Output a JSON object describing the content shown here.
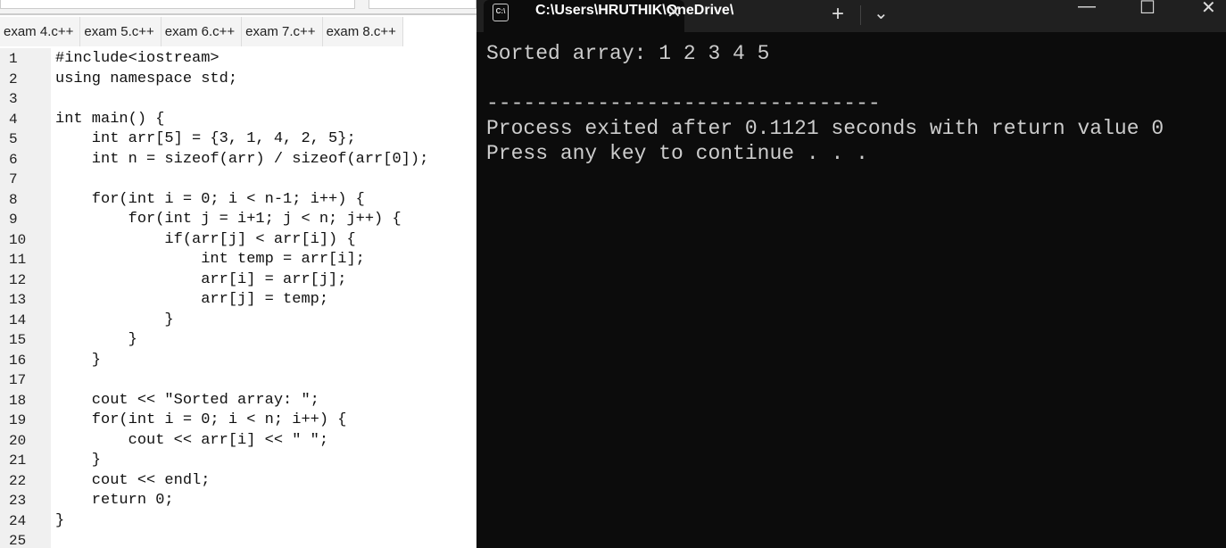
{
  "editor": {
    "tabs": [
      "exam 4.c++",
      "exam 5.c++",
      "exam 6.c++",
      "exam 7.c++",
      "exam 8.c++"
    ],
    "lines": [
      "#include<iostream>",
      "using namespace std;",
      "",
      "int main() {",
      "    int arr[5] = {3, 1, 4, 2, 5};",
      "    int n = sizeof(arr) / sizeof(arr[0]);",
      "",
      "    for(int i = 0; i < n-1; i++) {",
      "        for(int j = i+1; j < n; j++) {",
      "            if(arr[j] < arr[i]) {",
      "                int temp = arr[i];",
      "                arr[i] = arr[j];",
      "                arr[j] = temp;",
      "            }",
      "        }",
      "    }",
      "",
      "    cout << \"Sorted array: \";",
      "    for(int i = 0; i < n; i++) {",
      "        cout << arr[i] << \" \";",
      "    }",
      "    cout << endl;",
      "    return 0;",
      "}",
      ""
    ]
  },
  "terminal": {
    "tab_title": "C:\\Users\\HRUTHIK\\OneDrive\\",
    "icon_text": "C:\\",
    "close": "✕",
    "new_tab": "+",
    "dropdown": "⌄",
    "minimize": "—",
    "maximize": "☐",
    "close_window": "✕",
    "output": [
      "Sorted array: 1 2 3 4 5",
      "",
      "--------------------------------",
      "Process exited after 0.1121 seconds with return value 0",
      "Press any key to continue . . ."
    ]
  }
}
